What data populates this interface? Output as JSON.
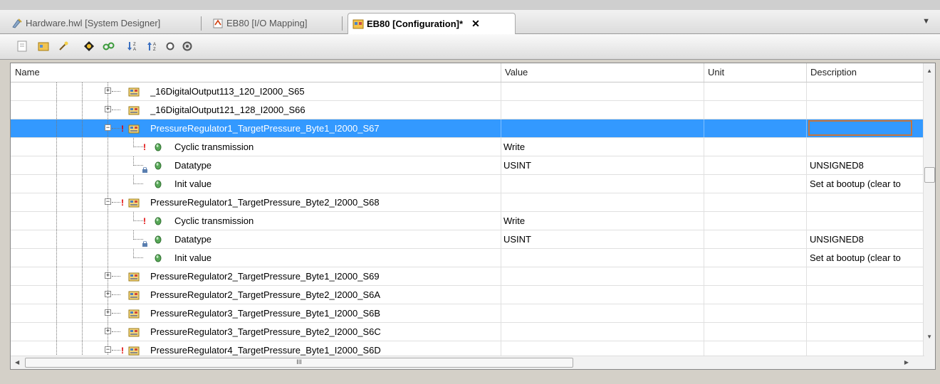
{
  "tabs": [
    {
      "label": "Hardware.hwl [System Designer]",
      "active": false,
      "icon": "hardware-designer-icon"
    },
    {
      "label": "EB80 [I/O Mapping]",
      "active": false,
      "icon": "io-mapping-icon"
    },
    {
      "label": "EB80 [Configuration]*",
      "active": true,
      "icon": "configuration-icon"
    }
  ],
  "close_glyph": "✕",
  "dropdown_glyph": "▼",
  "toolbar_icons": [
    "page-icon",
    "module-icon",
    "wand-icon",
    "target-icon",
    "link-icon",
    "sort-descending-icon",
    "sort-ascending-icon",
    "circle-icon",
    "gear-circle-icon"
  ],
  "columns": {
    "name": "Name",
    "value": "Value",
    "unit": "Unit",
    "description": "Description"
  },
  "rows": [
    {
      "name": "_16DigitalOutput113_120_I2000_S65",
      "value": "",
      "unit": "",
      "description": "",
      "level": 0,
      "expander": "+"
    },
    {
      "name": "_16DigitalOutput121_128_I2000_S66",
      "value": "",
      "unit": "",
      "description": "",
      "level": 0,
      "expander": "+"
    },
    {
      "name": "PressureRegulator1_TargetPressure_Byte1_I2000_S67",
      "value": "",
      "unit": "",
      "description": "",
      "level": 0,
      "expander": "-",
      "selected": true,
      "warning": true
    },
    {
      "name": "Cyclic transmission",
      "value": "Write",
      "unit": "",
      "description": "",
      "level": 1,
      "warning": true
    },
    {
      "name": "Datatype",
      "value": "USINT",
      "unit": "",
      "description": "UNSIGNED8",
      "level": 1,
      "locked": true
    },
    {
      "name": "Init value",
      "value": "",
      "unit": "",
      "description": "Set at bootup (clear to",
      "level": 1
    },
    {
      "name": "PressureRegulator1_TargetPressure_Byte2_I2000_S68",
      "value": "",
      "unit": "",
      "description": "",
      "level": 0,
      "expander": "-",
      "warning": true
    },
    {
      "name": "Cyclic transmission",
      "value": "Write",
      "unit": "",
      "description": "",
      "level": 1,
      "warning": true
    },
    {
      "name": "Datatype",
      "value": "USINT",
      "unit": "",
      "description": "UNSIGNED8",
      "level": 1,
      "locked": true
    },
    {
      "name": "Init value",
      "value": "",
      "unit": "",
      "description": "Set at bootup (clear to",
      "level": 1
    },
    {
      "name": "PressureRegulator2_TargetPressure_Byte1_I2000_S69",
      "value": "",
      "unit": "",
      "description": "",
      "level": 0,
      "expander": "+"
    },
    {
      "name": "PressureRegulator2_TargetPressure_Byte2_I2000_S6A",
      "value": "",
      "unit": "",
      "description": "",
      "level": 0,
      "expander": "+"
    },
    {
      "name": "PressureRegulator3_TargetPressure_Byte1_I2000_S6B",
      "value": "",
      "unit": "",
      "description": "",
      "level": 0,
      "expander": "+"
    },
    {
      "name": "PressureRegulator3_TargetPressure_Byte2_I2000_S6C",
      "value": "",
      "unit": "",
      "description": "",
      "level": 0,
      "expander": "+"
    },
    {
      "name": "PressureRegulator4_TargetPressure_Byte1_I2000_S6D",
      "value": "",
      "unit": "",
      "description": "",
      "level": 0,
      "expander": "-",
      "warning": true
    }
  ],
  "hscroll_grip": "III",
  "colors": {
    "selection": "#3399ff",
    "focus_border": "#c8743a",
    "warning": "#e00000"
  }
}
